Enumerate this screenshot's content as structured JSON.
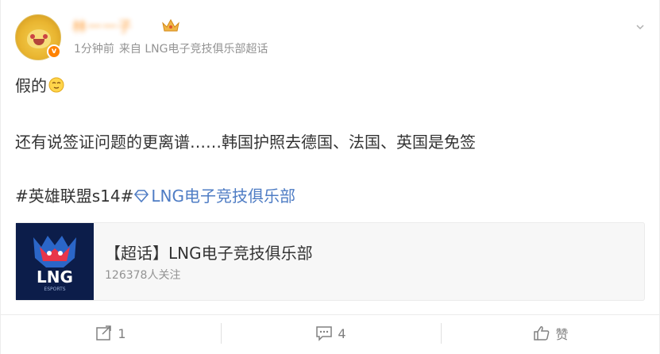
{
  "post": {
    "username": "林一一子",
    "meta": {
      "time": "1分钟前",
      "source": "来自 LNG电子竞技俱乐部超话"
    },
    "lines": {
      "line1": "假的",
      "line2": "还有说签证问题的更离谱……韩国护照去德国、法国、英国是免签",
      "line3_topic": "#英雄联盟s14#",
      "line3_link": "LNG电子竞技俱乐部"
    }
  },
  "supertopic_card": {
    "title": "【超话】LNG电子竞技俱乐部",
    "subtitle": "126378人关注"
  },
  "footer": {
    "repost_count": "1",
    "comment_count": "4",
    "like_label": "赞"
  },
  "colors": {
    "accent": "#ff8200",
    "link": "#4e7cc4",
    "muted": "#939393",
    "logo_bg": "#0c1d4a"
  },
  "icons": [
    "avatar",
    "verified-badge-icon",
    "crown-icon",
    "chevron-down-icon",
    "emoji-icon",
    "supertopic-diamond-icon",
    "repost-icon",
    "comment-icon",
    "like-icon"
  ]
}
